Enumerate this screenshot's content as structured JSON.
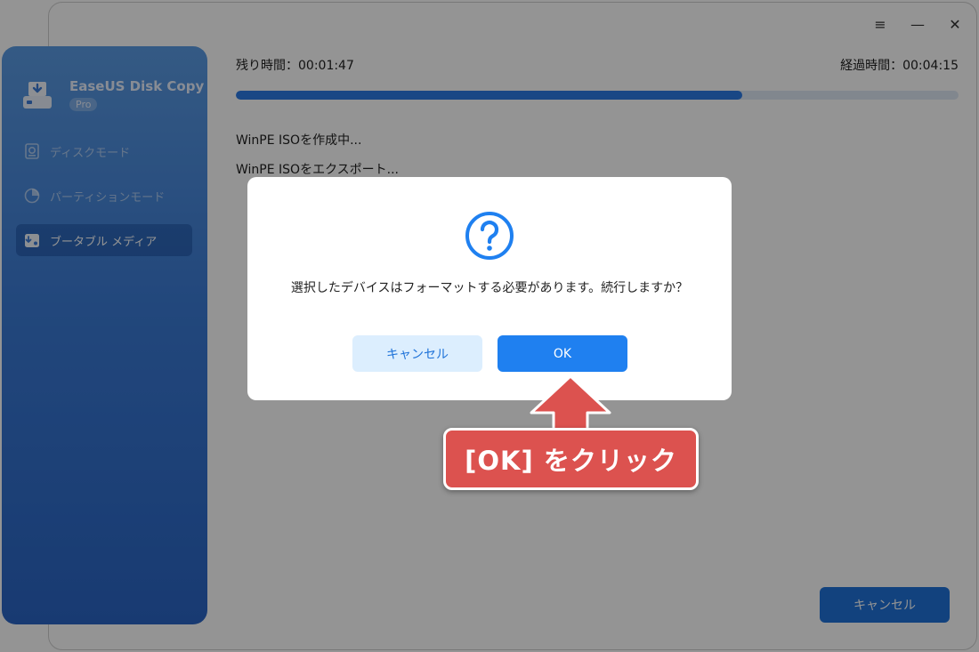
{
  "window": {
    "controls": {
      "menu": "≡",
      "minimize": "—",
      "close": "✕"
    }
  },
  "sidebar": {
    "app_name": "EaseUS Disk Copy",
    "edition_badge": "Pro",
    "items": [
      {
        "label": "ディスクモード",
        "icon": "disk-mode-icon",
        "active": false
      },
      {
        "label": "パーティションモード",
        "icon": "partition-mode-icon",
        "active": false
      },
      {
        "label": "ブータブル メディア",
        "icon": "bootable-media-icon",
        "active": true
      }
    ]
  },
  "progress": {
    "remaining_label": "残り時間：00:01:47",
    "elapsed_label": "経過時間：00:04:15",
    "fraction": 0.701
  },
  "log": {
    "lines": [
      "WinPE ISOを作成中...",
      "WinPE ISOをエクスポート..."
    ]
  },
  "footer": {
    "cancel_label": "キャンセル"
  },
  "dialog": {
    "icon": "question-icon",
    "message": "選択したデバイスはフォーマットする必要があります。続行しますか？",
    "cancel_label": "キャンセル",
    "ok_label": "OK"
  },
  "annotation": {
    "text": "[OK] をクリック"
  },
  "colors": {
    "accent": "#1f80f0",
    "callout": "#dc524f"
  }
}
